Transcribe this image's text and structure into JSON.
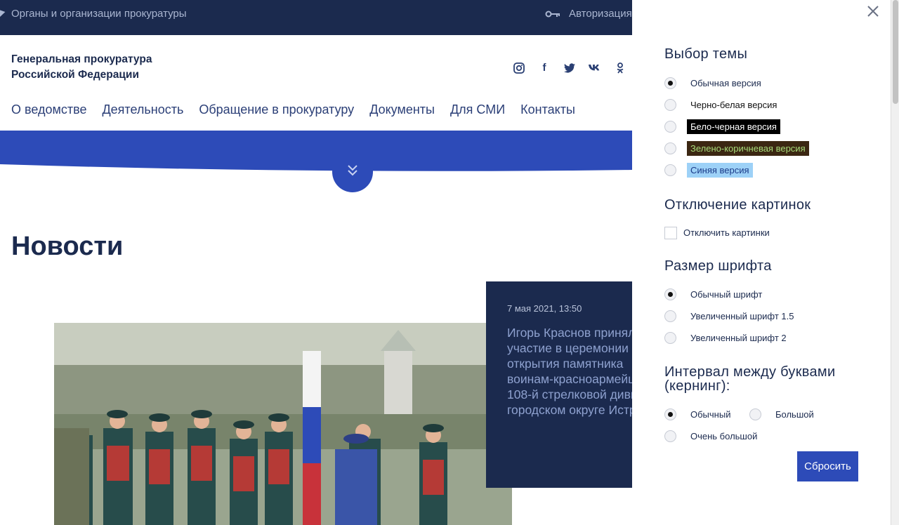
{
  "topbar": {
    "org_link": "Органы и организации прокуратуры",
    "auth_label": "Авторизация"
  },
  "header": {
    "brand_line1": "Генеральная прокуратура",
    "brand_line2": "Российской Федерации",
    "social_icons": [
      "instagram-icon",
      "facebook-icon",
      "twitter-icon",
      "vk-icon",
      "odnoklassniki-icon"
    ]
  },
  "menu": [
    "О ведомстве",
    "Деятельность",
    "Обращение в прокуратуру",
    "Документы",
    "Для СМИ",
    "Контакты"
  ],
  "content": {
    "page_title": "Новости",
    "news": {
      "date": "7 мая 2021, 13:50",
      "headline": "Игорь Краснов принял участие в церемонии открытия памятника воинам-красноармейц 108-й стрелковой диви городском округе Истр"
    }
  },
  "settings": {
    "theme_title": "Выбор темы",
    "themes": [
      "Обычная версия",
      "Черно-белая версия",
      "Бело-черная версия",
      "Зелено-коричневая версия",
      "Синяя версия"
    ],
    "theme_selected": 0,
    "images_title": "Отключение картинок",
    "images_checkbox": "Отключить картинки",
    "font_title": "Размер шрифта",
    "fonts": [
      "Обычный шрифт",
      "Увеличенный шрифт 1.5",
      "Увеличенный шрифт 2"
    ],
    "font_selected": 0,
    "kerning_title_line1": "Интервал между буквами",
    "kerning_title_line2": "(кернинг):",
    "kerning": [
      "Обычный",
      "Большой",
      "Очень большой"
    ],
    "kerning_selected": 0,
    "reset_label": "Сбросить"
  },
  "colors": {
    "navy": "#1b2a4e",
    "accent": "#2d4bb8"
  }
}
